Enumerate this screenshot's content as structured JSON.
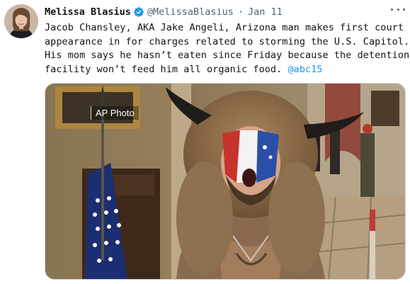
{
  "author": {
    "display_name": "Melissa Blasius",
    "handle": "@MelissaBlasius",
    "separator": "·",
    "date": "Jan 11",
    "verified": true,
    "avatar_icon": "profile-photo"
  },
  "tweet": {
    "lines": [
      "Jacob Chansley, AKA Jake Angeli, Arizona man makes first court",
      "appearance in for charges related to storming the U.S. Capitol.",
      "His mom says he hasn’t eaten since Friday because the detention",
      "facility won’t feed him all organic food."
    ],
    "mention": "@abc15"
  },
  "media": {
    "credit": "AP Photo"
  },
  "colors": {
    "link": "#1d9bf0",
    "verified": "#1d9bf0",
    "secondary_text": "#536471"
  }
}
